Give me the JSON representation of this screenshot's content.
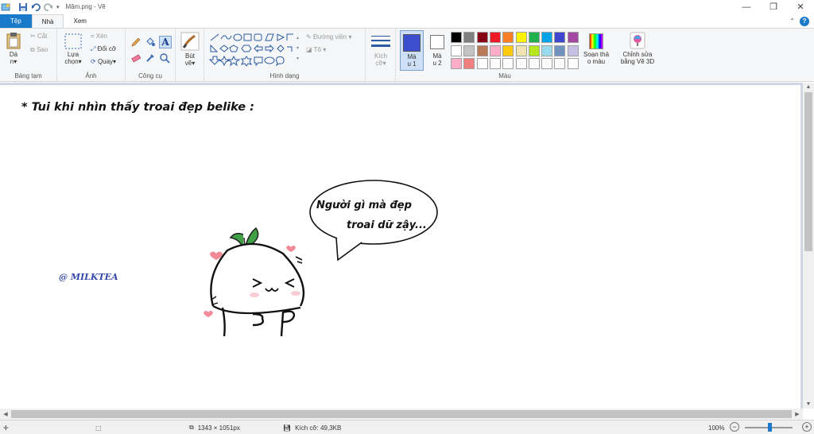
{
  "window": {
    "title": "Mãm.png - Vẽ",
    "controls": [
      "minimize",
      "restore",
      "close"
    ]
  },
  "tabs": [
    {
      "label": "Tệp"
    },
    {
      "label": "Nhà"
    },
    {
      "label": "Xem"
    }
  ],
  "ribbon": {
    "clipboard": {
      "paste": "Dá\nn▾",
      "cut": "Cắt",
      "copy": "Sao",
      "group": "Bảng tạm"
    },
    "image": {
      "select": "Lựa\nchọn▾",
      "crop": "Xén",
      "resize": "Đổi cỡ",
      "rotate": "Quay▾",
      "group": "Ảnh"
    },
    "tools": {
      "group": "Công cụ"
    },
    "brushes": {
      "label": "Bút\nvẽ▾"
    },
    "shapes": {
      "outline": "Đường viền ▾",
      "fill": "Tô ▾",
      "group": "Hình dạng"
    },
    "size": {
      "label": "Kích\ncỡ▾"
    },
    "color1": {
      "label": "Mà\nu 1",
      "color": "#3c4fcf"
    },
    "color2": {
      "label": "Mà\nu 2",
      "color": "#ffffff"
    },
    "edit_colors": {
      "label": "Soạn thả\no màu"
    },
    "paint3d": {
      "label": "Chỉnh sửa\nbằng Vẽ 3D"
    },
    "colors_group": "Màu",
    "palette": [
      "#000000",
      "#7f7f7f",
      "#880015",
      "#ed1c24",
      "#ff7f27",
      "#fff200",
      "#22b14c",
      "#00a2e8",
      "#3f48cc",
      "#a349a4",
      "#ffffff",
      "#c3c3c3",
      "#b97a57",
      "#ffaec9",
      "#ffc90e",
      "#efe4b0",
      "#b5e61d",
      "#99d9ea",
      "#7092be",
      "#c8bfe7",
      "#ffaec9",
      "#f08080",
      "#ffffff",
      "#ffffff",
      "#ffffff",
      "#ffffff",
      "#ffffff",
      "#ffffff",
      "#ffffff",
      "#ffffff"
    ]
  },
  "canvas": {
    "heading": "* Tui khi nhìn thấy troai đẹp belike :",
    "signature": "@ MILKTEA",
    "bubble_line1": "Người gì mà đẹp",
    "bubble_line2": "troai dữ zậy..."
  },
  "status": {
    "dimensions": "1343 × 1051px",
    "filesize": "Kích cỡ: 49,3KB",
    "zoom": "100%"
  }
}
